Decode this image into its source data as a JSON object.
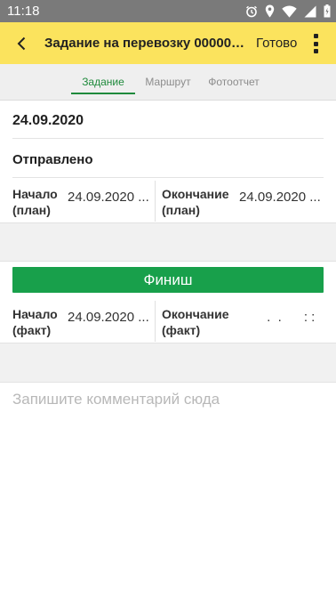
{
  "status_bar": {
    "time": "11:18",
    "icons": [
      "alarm-icon",
      "location-icon",
      "wifi-icon",
      "signal-icon",
      "battery-icon"
    ]
  },
  "app_bar": {
    "title": "Задание на перевозку 000000...",
    "done_label": "Готово",
    "icons": [
      "back-arrow-icon",
      "more-vert-icon"
    ],
    "bg_color": "#fbe35d"
  },
  "tabs": [
    {
      "label": "Задание",
      "active": true
    },
    {
      "label": "Маршрут",
      "active": false
    },
    {
      "label": "Фотоотчет",
      "active": false
    }
  ],
  "task": {
    "date": "24.09.2020",
    "status": "Отправлено",
    "plan": {
      "start_label": "Начало (план)",
      "start_value": "24.09.2020 ...",
      "end_label": "Окончание (план)",
      "end_value": "24.09.2020 ..."
    }
  },
  "finish_button": {
    "label": "Финиш",
    "color": "#18a04b"
  },
  "fact": {
    "start_label": "Начало (факт)",
    "start_value": "24.09.2020 ...",
    "end_label": "Окончание (факт)",
    "end_value": " .  .      : :"
  },
  "comment": {
    "placeholder": "Запишите комментарий сюда"
  },
  "colors": {
    "accent": "#1f8a3c",
    "app_bar": "#fbe35d",
    "status_bar": "#7a7a7a"
  }
}
